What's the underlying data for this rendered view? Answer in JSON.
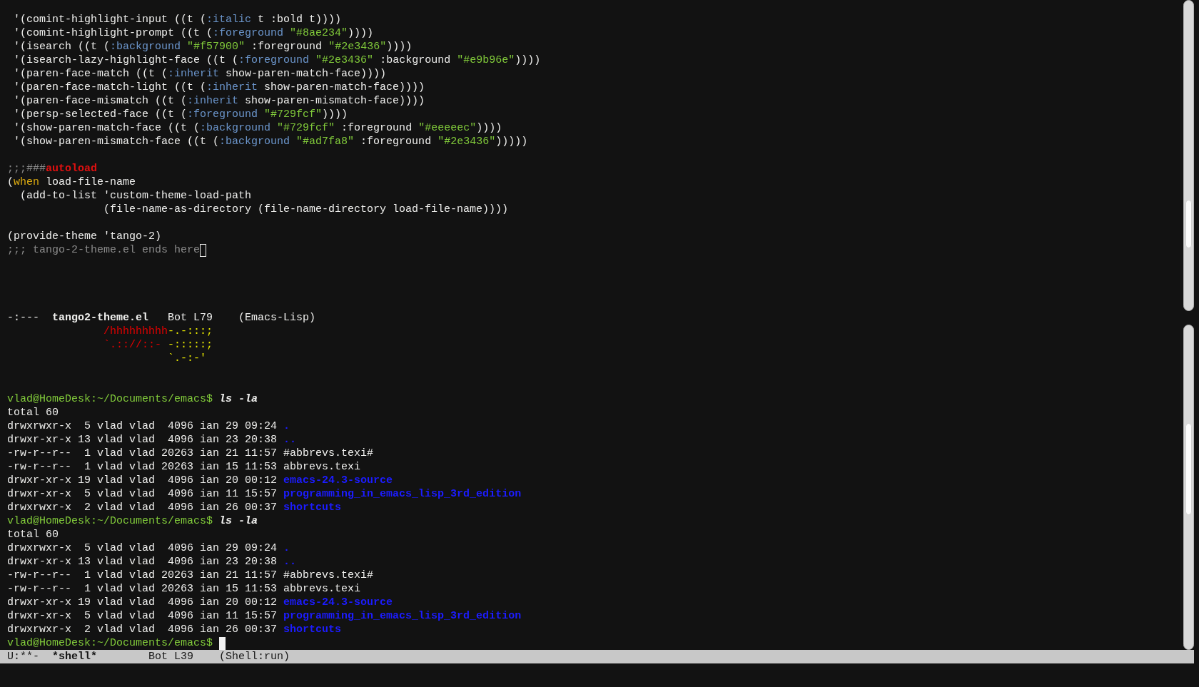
{
  "editor_window": {
    "blocks": [
      [
        {
          "segments": [
            {
              "kind": "plain",
              "text": " '(comint-highlight-input ((t ("
            },
            {
              "kind": "keyword",
              "text": ":italic"
            },
            {
              "kind": "plain",
              "text": " t :bold t))))"
            }
          ]
        },
        {
          "segments": [
            {
              "kind": "plain",
              "text": " '(comint-highlight-prompt ((t ("
            },
            {
              "kind": "keyword",
              "text": ":foreground"
            },
            {
              "kind": "string",
              "text": " \"#8ae234\""
            },
            {
              "kind": "plain",
              "text": "))))"
            }
          ]
        },
        {
          "segments": [
            {
              "kind": "plain",
              "text": " '(isearch ((t ("
            },
            {
              "kind": "keyword",
              "text": ":background"
            },
            {
              "kind": "string",
              "text": " \"#f57900\""
            },
            {
              "kind": "plain",
              "text": " :foreground "
            },
            {
              "kind": "string",
              "text": "\"#2e3436\""
            },
            {
              "kind": "plain",
              "text": "))))"
            }
          ]
        },
        {
          "segments": [
            {
              "kind": "plain",
              "text": " '(isearch-lazy-highlight-face ((t ("
            },
            {
              "kind": "keyword",
              "text": ":foreground"
            },
            {
              "kind": "string",
              "text": " \"#2e3436\""
            },
            {
              "kind": "plain",
              "text": " :background "
            },
            {
              "kind": "string",
              "text": "\"#e9b96e\""
            },
            {
              "kind": "plain",
              "text": "))))"
            }
          ]
        },
        {
          "segments": [
            {
              "kind": "plain",
              "text": " '(paren-face-match ((t ("
            },
            {
              "kind": "keyword",
              "text": ":inherit"
            },
            {
              "kind": "plain",
              "text": " show-paren-match-face))))"
            }
          ]
        },
        {
          "segments": [
            {
              "kind": "plain",
              "text": " '(paren-face-match-light ((t ("
            },
            {
              "kind": "keyword",
              "text": ":inherit"
            },
            {
              "kind": "plain",
              "text": " show-paren-match-face))))"
            }
          ]
        },
        {
          "segments": [
            {
              "kind": "plain",
              "text": " '(paren-face-mismatch ((t ("
            },
            {
              "kind": "keyword",
              "text": ":inherit"
            },
            {
              "kind": "plain",
              "text": " show-paren-mismatch-face))))"
            }
          ]
        },
        {
          "segments": [
            {
              "kind": "plain",
              "text": " '(persp-selected-face ((t ("
            },
            {
              "kind": "keyword",
              "text": ":foreground"
            },
            {
              "kind": "string",
              "text": " \"#729fcf\""
            },
            {
              "kind": "plain",
              "text": "))))"
            }
          ]
        },
        {
          "segments": [
            {
              "kind": "plain",
              "text": " '(show-paren-match-face ((t ("
            },
            {
              "kind": "keyword",
              "text": ":background"
            },
            {
              "kind": "string",
              "text": " \"#729fcf\""
            },
            {
              "kind": "plain",
              "text": " :foreground "
            },
            {
              "kind": "string",
              "text": "\"#eeeeec\""
            },
            {
              "kind": "plain",
              "text": "))))"
            }
          ]
        },
        {
          "segments": [
            {
              "kind": "plain",
              "text": " '(show-paren-mismatch-face ((t ("
            },
            {
              "kind": "keyword",
              "text": ":background"
            },
            {
              "kind": "string",
              "text": " \"#ad7fa8\""
            },
            {
              "kind": "plain",
              "text": " :foreground "
            },
            {
              "kind": "string",
              "text": "\"#2e3436\""
            },
            {
              "kind": "plain",
              "text": ")))))"
            }
          ]
        }
      ],
      [
        {
          "segments": [
            {
              "kind": "comment",
              "text": ";;;###"
            },
            {
              "kind": "warning",
              "text": "autoload"
            }
          ]
        },
        {
          "segments": [
            {
              "kind": "plain",
              "text": "("
            },
            {
              "kind": "builtin",
              "text": "when"
            },
            {
              "kind": "plain",
              "text": " load-file-name"
            }
          ]
        },
        {
          "segments": [
            {
              "kind": "plain",
              "text": "  (add-to-list 'custom-theme-load-path"
            }
          ]
        },
        {
          "segments": [
            {
              "kind": "plain",
              "text": "               (file-name-as-directory (file-name-directory load-file-name))))"
            }
          ]
        }
      ],
      [
        {
          "segments": [
            {
              "kind": "plain",
              "text": "(provide-theme 'tango-2)"
            }
          ]
        },
        {
          "segments": [
            {
              "kind": "comment",
              "text": ";;; tango-2-theme.el ends here"
            }
          ],
          "cursor": true
        }
      ]
    ],
    "mode_line": {
      "active": false,
      "status": "-:---",
      "buffer": "tango2-theme.el",
      "position": "Bot L79",
      "mode": "(Emacs-Lisp)"
    }
  },
  "shell_window": {
    "banner": [
      {
        "segments": [
          {
            "color": "#e00000",
            "text": "               /hhhhhhhhh"
          },
          {
            "color": "#e6e600",
            "text": "-.-:::;"
          }
        ]
      },
      {
        "segments": [
          {
            "color": "#e00000",
            "text": "               `.:://::-"
          },
          {
            "color": "#e6e600",
            "text": " -:::::;"
          }
        ]
      },
      {
        "segments": [
          {
            "color": "#e6e600",
            "text": "                         `.-:-'"
          }
        ]
      }
    ],
    "session": [
      {
        "prompt": "vlad@HomeDesk:~/Documents/emacs$",
        "command": "ls -la",
        "output": {
          "total": "total 60",
          "entries": [
            {
              "info": "drwxrwxr-x  5 vlad vlad  4096 ian 29 09:24",
              "name": ".",
              "kind": "directory"
            },
            {
              "info": "drwxr-xr-x 13 vlad vlad  4096 ian 23 20:38",
              "name": "..",
              "kind": "directory"
            },
            {
              "info": "-rw-r--r--  1 vlad vlad 20263 ian 21 11:57",
              "name": "#abbrevs.texi#",
              "kind": "file"
            },
            {
              "info": "-rw-r--r--  1 vlad vlad 20263 ian 15 11:53",
              "name": "abbrevs.texi",
              "kind": "file"
            },
            {
              "info": "drwxr-xr-x 19 vlad vlad  4096 ian 20 00:12",
              "name": "emacs-24.3-source",
              "kind": "directory"
            },
            {
              "info": "drwxr-xr-x  5 vlad vlad  4096 ian 11 15:57",
              "name": "programming_in_emacs_lisp_3rd_edition",
              "kind": "directory"
            },
            {
              "info": "drwxrwxr-x  2 vlad vlad  4096 ian 26 00:37",
              "name": "shortcuts",
              "kind": "directory"
            }
          ]
        }
      },
      {
        "prompt": "vlad@HomeDesk:~/Documents/emacs$",
        "command": "ls -la",
        "output": {
          "total": "total 60",
          "entries": [
            {
              "info": "drwxrwxr-x  5 vlad vlad  4096 ian 29 09:24",
              "name": ".",
              "kind": "directory"
            },
            {
              "info": "drwxr-xr-x 13 vlad vlad  4096 ian 23 20:38",
              "name": "..",
              "kind": "directory"
            },
            {
              "info": "-rw-r--r--  1 vlad vlad 20263 ian 21 11:57",
              "name": "#abbrevs.texi#",
              "kind": "file"
            },
            {
              "info": "-rw-r--r--  1 vlad vlad 20263 ian 15 11:53",
              "name": "abbrevs.texi",
              "kind": "file"
            },
            {
              "info": "drwxr-xr-x 19 vlad vlad  4096 ian 20 00:12",
              "name": "emacs-24.3-source",
              "kind": "directory"
            },
            {
              "info": "drwxr-xr-x  5 vlad vlad  4096 ian 11 15:57",
              "name": "programming_in_emacs_lisp_3rd_edition",
              "kind": "directory"
            },
            {
              "info": "drwxrwxr-x  2 vlad vlad  4096 ian 26 00:37",
              "name": "shortcuts",
              "kind": "directory"
            }
          ]
        }
      },
      {
        "prompt": "vlad@HomeDesk:~/Documents/emacs$",
        "cursor": true
      }
    ],
    "mode_line": {
      "active": true,
      "status": "U:**-",
      "buffer": "*shell*",
      "position": "Bot L39",
      "mode": "(Shell:run)"
    }
  }
}
